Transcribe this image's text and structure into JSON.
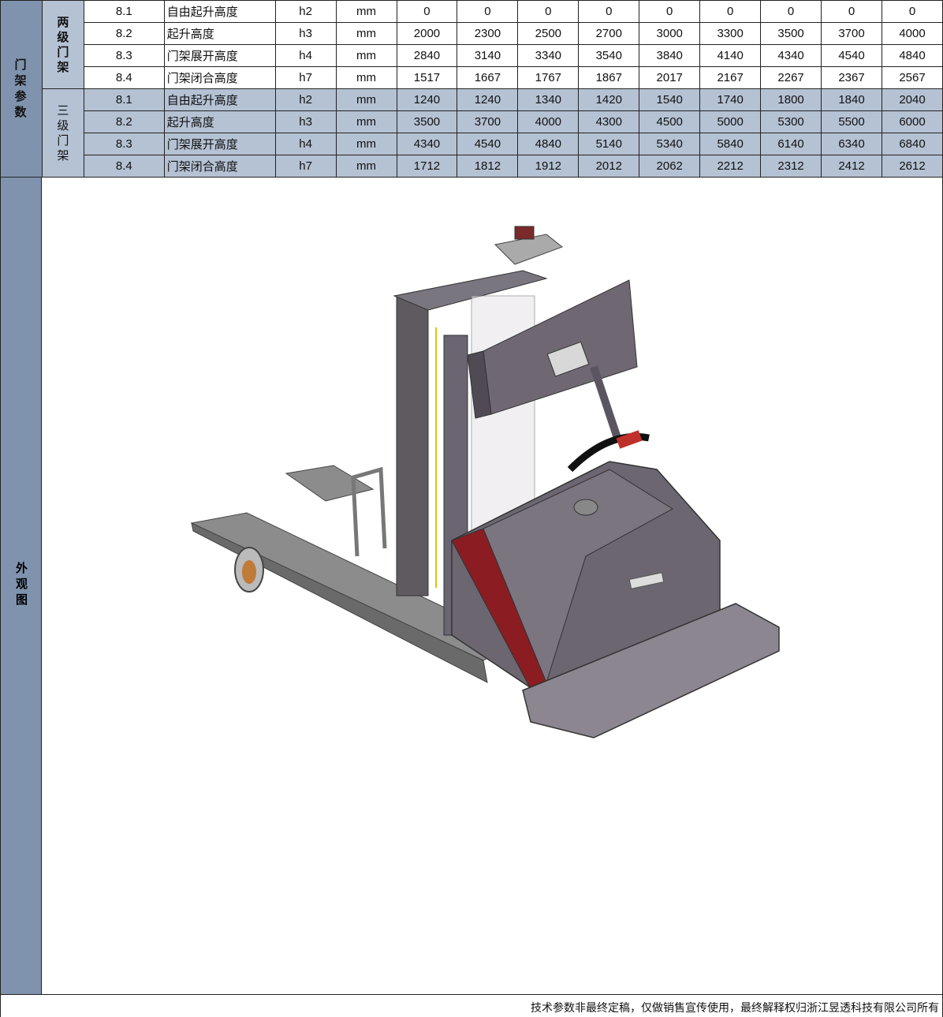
{
  "mast_section": {
    "title_chars": [
      "门",
      "架",
      "参",
      "数"
    ],
    "two_stage": {
      "label_chars": [
        "两",
        "级",
        "门",
        "架"
      ],
      "rows": [
        {
          "no": "8.1",
          "desc": "自由起升高度",
          "sym": "h2",
          "unit": "mm",
          "vals": [
            "0",
            "0",
            "0",
            "0",
            "0",
            "0",
            "0",
            "0",
            "0"
          ]
        },
        {
          "no": "8.2",
          "desc": "起升高度",
          "sym": "h3",
          "unit": "mm",
          "vals": [
            "2000",
            "2300",
            "2500",
            "2700",
            "3000",
            "3300",
            "3500",
            "3700",
            "4000"
          ]
        },
        {
          "no": "8.3",
          "desc": "门架展开高度",
          "sym": "h4",
          "unit": "mm",
          "vals": [
            "2840",
            "3140",
            "3340",
            "3540",
            "3840",
            "4140",
            "4340",
            "4540",
            "4840"
          ]
        },
        {
          "no": "8.4",
          "desc": "门架闭合高度",
          "sym": "h7",
          "unit": "mm",
          "vals": [
            "1517",
            "1667",
            "1767",
            "1867",
            "2017",
            "2167",
            "2267",
            "2367",
            "2567"
          ]
        }
      ]
    },
    "three_stage": {
      "label_chars": [
        "三",
        "级",
        "门",
        "架"
      ],
      "rows": [
        {
          "no": "8.1",
          "desc": "自由起升高度",
          "sym": "h2",
          "unit": "mm",
          "vals": [
            "1240",
            "1240",
            "1340",
            "1420",
            "1540",
            "1740",
            "1800",
            "1840",
            "2040"
          ]
        },
        {
          "no": "8.2",
          "desc": "起升高度",
          "sym": "h3",
          "unit": "mm",
          "vals": [
            "3500",
            "3700",
            "4000",
            "4300",
            "4500",
            "5000",
            "5300",
            "5500",
            "6000"
          ]
        },
        {
          "no": "8.3",
          "desc": "门架展开高度",
          "sym": "h4",
          "unit": "mm",
          "vals": [
            "4340",
            "4540",
            "4840",
            "5140",
            "5340",
            "5840",
            "6140",
            "6340",
            "6840"
          ]
        },
        {
          "no": "8.4",
          "desc": "门架闭合高度",
          "sym": "h7",
          "unit": "mm",
          "vals": [
            "1712",
            "1812",
            "1912",
            "2012",
            "2062",
            "2212",
            "2312",
            "2412",
            "2612"
          ]
        }
      ]
    }
  },
  "appearance": {
    "label_chars": [
      "外",
      "观",
      "图"
    ],
    "image_icon": "forklift-agv-illustration"
  },
  "footer": {
    "note": "技术参数非最终定稿，仅做销售宣传使用，最终解释权归浙江昱透科技有限公司所有"
  },
  "colors": {
    "section_header": "#7f93ae",
    "sub_header": "#b5c2d4",
    "body_accent": "#8a1c22",
    "body_gray": "#6b6670"
  }
}
